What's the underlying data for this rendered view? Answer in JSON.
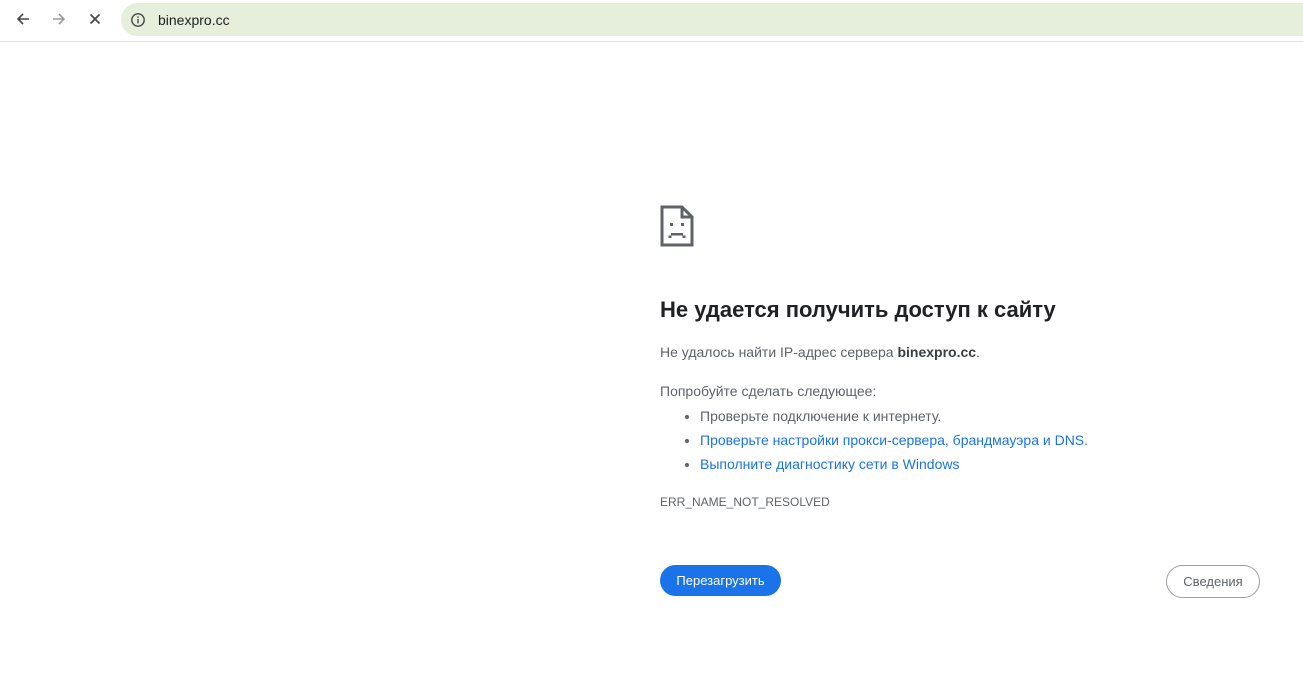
{
  "browser": {
    "url": "binexpro.cc",
    "icons": {
      "back": "back-arrow-icon",
      "forward": "forward-arrow-icon",
      "stop": "close-icon",
      "site_info": "info-icon"
    },
    "omnibox_color": "#e6eedc"
  },
  "error_page": {
    "icon": "sad-document-icon",
    "title": "Не удается получить доступ к сайту",
    "description_prefix": "Не удалось найти IP-адрес сервера ",
    "description_host": "binexpro.cc",
    "description_suffix": ".",
    "try_heading": "Попробуйте сделать следующее:",
    "suggestions": [
      {
        "text": "Проверьте подключение к интернету.",
        "is_link": false
      },
      {
        "text": "Проверьте настройки прокси-сервера, брандмауэра и DNS.",
        "is_link": true
      },
      {
        "text": "Выполните диагностику сети в Windows",
        "is_link": true
      }
    ],
    "error_code": "ERR_NAME_NOT_RESOLVED",
    "reload_label": "Перезагрузить",
    "details_label": "Сведения",
    "colors": {
      "primary": "#1a73e8",
      "text_secondary": "#5f6368",
      "text_primary": "#202124"
    }
  }
}
